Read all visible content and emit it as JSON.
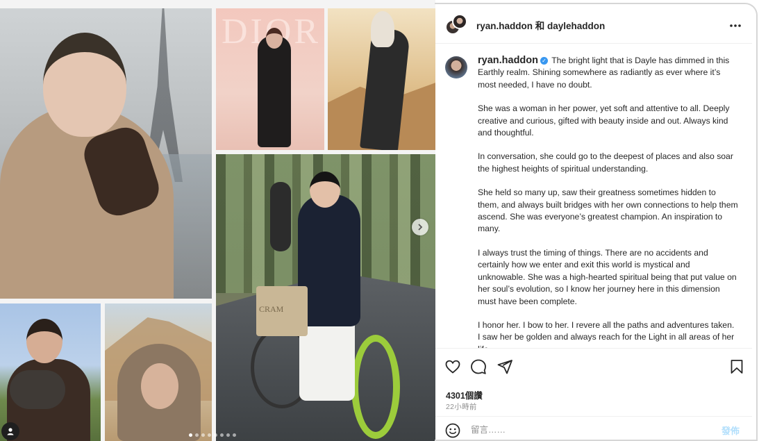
{
  "header": {
    "names": "ryan.haddon 和 daylehaddon"
  },
  "caption": {
    "username": "ryan.haddon",
    "paragraphs": [
      "The bright light that is Dayle has dimmed in this Earthly realm. Shining somewhere as radiantly as ever where it’s most needed, I have no doubt.",
      "She was a woman in her power, yet soft and attentive to all. Deeply creative and curious, gifted with beauty inside and out. Always kind and thoughtful.",
      "In conversation, she could go to the deepest of places and also soar the highest heights of spiritual understanding.",
      "She held so many up, saw their greatness sometimes hidden to them, and always built bridges with her own connections to help them ascend. She was everyone’s greatest champion. An inspiration to many.",
      "I always trust the timing of things. There are no accidents and certainly how we enter and exit this world is mystical and unknowable. She was a high-hearted spiritual being that put value on her soul’s evolution, so I know her journey here in this dimension must have been complete.",
      "I honor her. I bow to her. I revere all the paths and adventures taken. I saw her be golden and always reach for the Light in all areas of her life."
    ]
  },
  "collage": {
    "dior_text": "DIOR",
    "bag_text": "CRAM",
    "carousel_total": 8,
    "carousel_active": 1
  },
  "stats": {
    "likes": "4301個讚",
    "time": "22小時前"
  },
  "comment": {
    "placeholder": "留言……",
    "post_label": "發佈"
  },
  "colors": {
    "verified": "#3897f0",
    "post_button": "#b2dffc",
    "muted": "#8e8e8e"
  },
  "icons": [
    "heart-icon",
    "comment-icon",
    "share-icon",
    "bookmark-icon",
    "more-icon",
    "emoji-icon",
    "chevron-right-icon",
    "user-tag-icon",
    "verified-icon"
  ]
}
